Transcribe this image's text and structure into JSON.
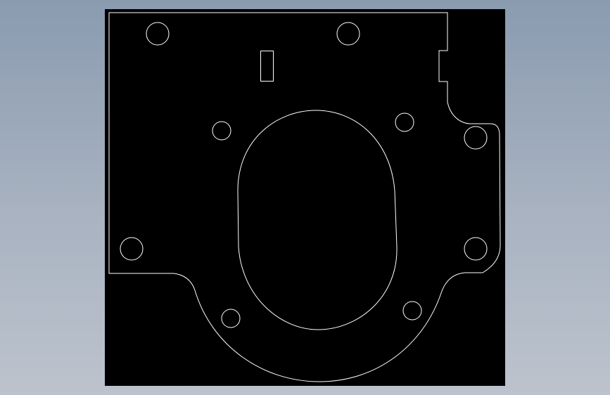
{
  "view": {
    "background_color": "#000000",
    "line_color": "#ffffff",
    "page_gradient_top": "#8a9bb0",
    "page_gradient_bottom": "#bcc3cd"
  },
  "drawing": {
    "part": "mounting-plate",
    "hole_count": 9,
    "slot_count": 1,
    "cutout_count": 1
  }
}
